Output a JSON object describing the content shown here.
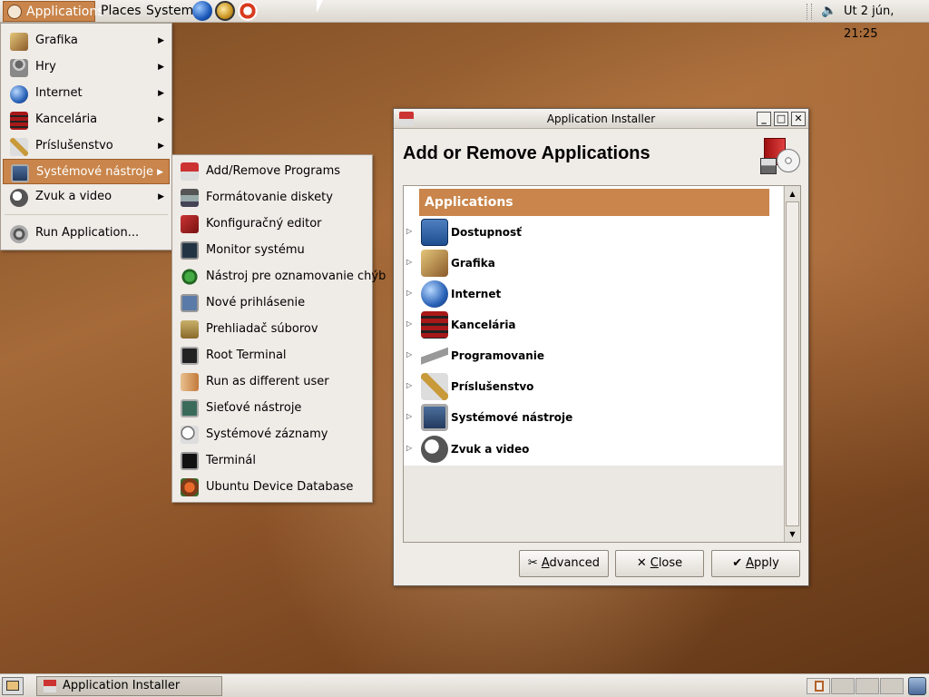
{
  "top_panel": {
    "applications": "Applications",
    "places": "Places",
    "system": "System",
    "clock": "Ut  2 jún, 21:25"
  },
  "main_menu": {
    "items": [
      {
        "label": "Grafika",
        "icon": "graphics-icon",
        "arrow": "▶"
      },
      {
        "label": "Hry",
        "icon": "games-icon",
        "arrow": "▶"
      },
      {
        "label": "Internet",
        "icon": "internet-icon",
        "arrow": "▶"
      },
      {
        "label": "Kancelária",
        "icon": "office-icon",
        "arrow": "▶"
      },
      {
        "label": "Príslušenstvo",
        "icon": "accessories-icon",
        "arrow": "▶"
      },
      {
        "label": "Systémové nástroje",
        "icon": "system-tools-icon",
        "arrow": "▶"
      },
      {
        "label": "Zvuk a video",
        "icon": "sound-video-icon",
        "arrow": "▶"
      }
    ],
    "run_application": "Run Application..."
  },
  "sub_menu": {
    "items": [
      {
        "label": "Add/Remove Programs",
        "icon": "add-remove-icon"
      },
      {
        "label": "Formátovanie diskety",
        "icon": "floppy-icon"
      },
      {
        "label": "Konfiguračný editor",
        "icon": "config-editor-icon"
      },
      {
        "label": "Monitor systému",
        "icon": "system-monitor-icon"
      },
      {
        "label": "Nástroj pre oznamovanie chýb",
        "icon": "bug-report-icon"
      },
      {
        "label": "Nové prihlásenie",
        "icon": "new-login-icon"
      },
      {
        "label": "Prehliadač súborov",
        "icon": "file-browser-icon"
      },
      {
        "label": "Root Terminal",
        "icon": "root-terminal-icon"
      },
      {
        "label": "Run as different user",
        "icon": "run-as-icon"
      },
      {
        "label": "Sieťové nástroje",
        "icon": "network-tools-icon"
      },
      {
        "label": "Systémové záznamy",
        "icon": "system-logs-icon"
      },
      {
        "label": "Terminál",
        "icon": "terminal-icon"
      },
      {
        "label": "Ubuntu Device Database",
        "icon": "device-database-icon"
      }
    ]
  },
  "window": {
    "title": "Application Installer",
    "heading": "Add or Remove Applications",
    "list_header": "Applications",
    "categories": [
      {
        "label": "Dostupnosť",
        "icon": "accessibility-icon"
      },
      {
        "label": "Grafika",
        "icon": "graphics-icon"
      },
      {
        "label": "Internet",
        "icon": "internet-icon"
      },
      {
        "label": "Kancelária",
        "icon": "office-icon"
      },
      {
        "label": "Programovanie",
        "icon": "programming-icon"
      },
      {
        "label": "Príslušenstvo",
        "icon": "accessories-icon"
      },
      {
        "label": "Systémové nástroje",
        "icon": "system-tools-icon"
      },
      {
        "label": "Zvuk a video",
        "icon": "sound-video-icon"
      }
    ],
    "buttons": {
      "advanced_u": "A",
      "advanced_rest": "dvanced",
      "close_u": "C",
      "close_rest": "lose",
      "apply_u": "A",
      "apply_rest": "pply"
    }
  },
  "taskbar": {
    "task_label": "Application Installer"
  },
  "colors": {
    "accent": "#c9854b",
    "panel": "#dcd7cf"
  }
}
